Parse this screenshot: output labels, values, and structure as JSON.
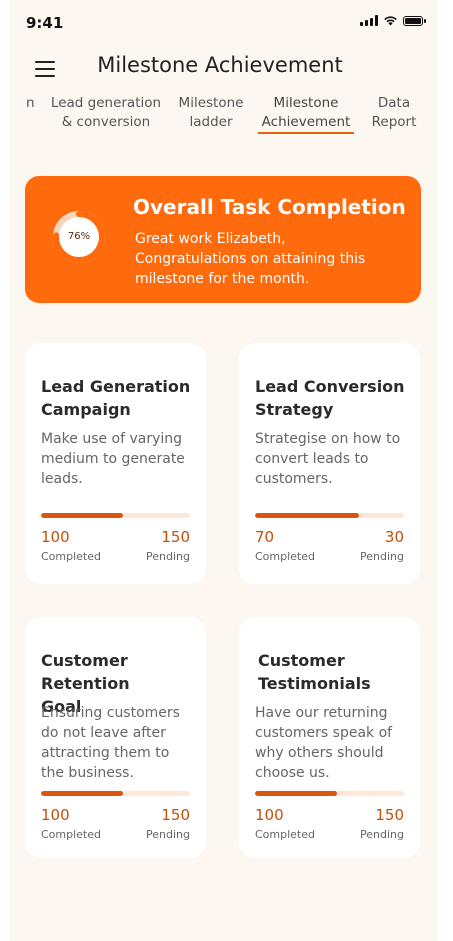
{
  "status": {
    "time": "9:41"
  },
  "header": {
    "title": "Milestone Achievement"
  },
  "tabs": [
    {
      "label": "n"
    },
    {
      "label": "Lead generation\n& conversion"
    },
    {
      "label": "Milestone\nladder"
    },
    {
      "label": "Milestone\nAchievement",
      "active": true
    },
    {
      "label": "Data\nReport"
    }
  ],
  "banner": {
    "percent_label": "76%",
    "percent": 76,
    "title": "Overall Task Completion",
    "message": "Great work Elizabeth, Congratulations on attaining this milestone for the month."
  },
  "cards": [
    {
      "title": "Lead Generation Campaign",
      "description": "Make use of varying medium to generate leads.",
      "completed": "100",
      "pending": "150",
      "progress": 0.55,
      "completed_label": "Completed",
      "pending_label": "Pending"
    },
    {
      "title": "Lead Conversion Strategy",
      "description": "Strategise on how to convert leads to customers.",
      "completed": "70",
      "pending": "30",
      "progress": 0.7,
      "completed_label": "Completed",
      "pending_label": "Pending"
    },
    {
      "title": "Customer Retention Goal",
      "description": "Ensuring customers do not leave after attracting them to the business.",
      "completed": "100",
      "pending": "150",
      "progress": 0.55,
      "completed_label": "Completed",
      "pending_label": "Pending"
    },
    {
      "title": "Customer Testimonials",
      "description": "Have our returning customers speak of why others should choose us.",
      "completed": "100",
      "pending": "150",
      "progress": 0.55,
      "completed_label": "Completed",
      "pending_label": "Pending"
    }
  ],
  "colors": {
    "accent": "#ff6a0d",
    "bar_fill": "#d9570b",
    "bar_track": "#fde8d8",
    "background": "#fdf7f2"
  }
}
